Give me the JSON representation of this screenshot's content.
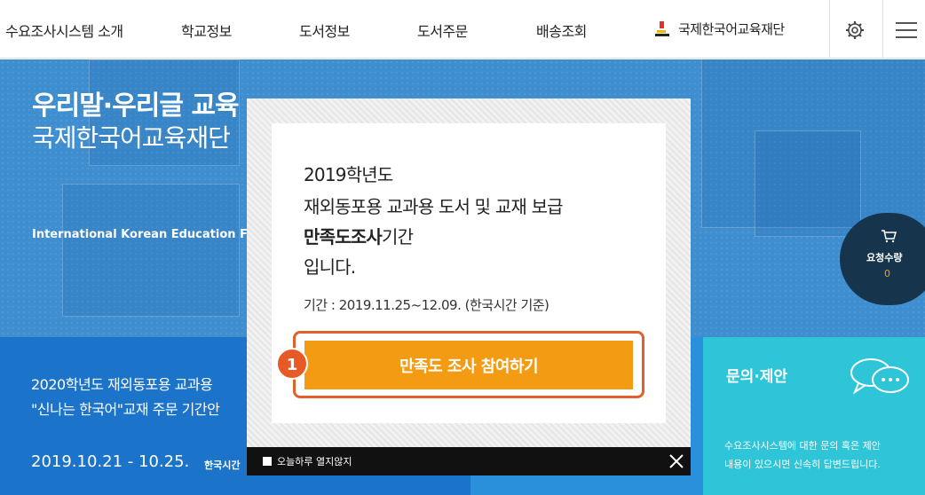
{
  "nav": {
    "items": [
      "수요조사시스템 소개",
      "학교정보",
      "도서정보",
      "도서주문",
      "배송조회"
    ],
    "org": "국제한국어교육재단"
  },
  "hero": {
    "title": "우리말·우리글 교육",
    "subtitle": "국제한국어교육재단",
    "english": "International Korean Education Foun"
  },
  "cart": {
    "label": "요청수량",
    "count": "0"
  },
  "notice": {
    "line1": "2020학년도 재외동포용 교과용",
    "line2": "\"신나는 한국어\"교재 주문 기간안",
    "date": "2019.10.21 - 10.25.",
    "tz": "한국시간"
  },
  "contact": {
    "title": "문의·제안",
    "desc1": "수요조사시스템에 대한 문의 혹은 제안",
    "desc2": "내용이 있으시면 신속히 답변드립니다."
  },
  "popup": {
    "year": "2019학년도",
    "line2": "재외동포용 교과용 도서 및 교재 보급",
    "line3_bold": "만족도조사",
    "line3_rest": "기간",
    "line4": "입니다.",
    "period": "기간 : 2019.11.25~12.09. (한국시간 기준)",
    "button": "만족도 조사 참여하기",
    "step": "1",
    "dont_show": "오늘하루 열지않지"
  },
  "colors": {
    "accent": "#f39b12",
    "hero": "#3f8fd0",
    "badge": "#e85a25"
  }
}
